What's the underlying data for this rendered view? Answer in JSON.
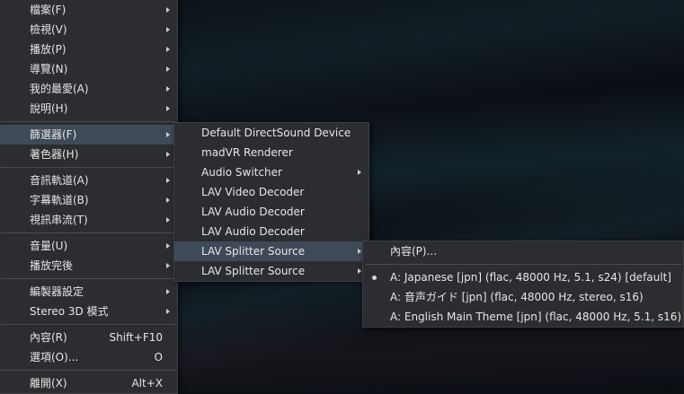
{
  "main_menu": {
    "groups": [
      [
        {
          "label": "檔案(F)",
          "submenu": true
        },
        {
          "label": "檢視(V)",
          "submenu": true
        },
        {
          "label": "播放(P)",
          "submenu": true
        },
        {
          "label": "導覽(N)",
          "submenu": true
        },
        {
          "label": "我的最愛(A)",
          "submenu": true
        },
        {
          "label": "說明(H)",
          "submenu": true
        }
      ],
      [
        {
          "label": "篩選器(F)",
          "submenu": true,
          "highlighted": true
        },
        {
          "label": "著色器(H)",
          "submenu": true
        }
      ],
      [
        {
          "label": "音訊軌道(A)",
          "submenu": true
        },
        {
          "label": "字幕軌道(B)",
          "submenu": true
        },
        {
          "label": "視訊串流(T)",
          "submenu": true
        }
      ],
      [
        {
          "label": "音量(U)",
          "submenu": true
        },
        {
          "label": "播放完後",
          "submenu": true
        }
      ],
      [
        {
          "label": "編製器設定",
          "submenu": true
        },
        {
          "label": "Stereo 3D 模式",
          "submenu": true
        }
      ],
      [
        {
          "label": "內容(R)",
          "shortcut": "Shift+F10"
        },
        {
          "label": "選項(O)...",
          "shortcut": "O"
        }
      ],
      [
        {
          "label": "離開(X)",
          "shortcut": "Alt+X"
        }
      ]
    ]
  },
  "filters_menu": {
    "items": [
      {
        "label": "Default DirectSound Device"
      },
      {
        "label": "madVR Renderer"
      },
      {
        "label": "Audio Switcher",
        "submenu": true
      },
      {
        "label": "LAV Video Decoder"
      },
      {
        "label": "LAV Audio Decoder"
      },
      {
        "label": "LAV Audio Decoder"
      },
      {
        "label": "LAV Splitter Source",
        "submenu": true,
        "highlighted": true
      },
      {
        "label": "LAV Splitter Source",
        "submenu": true
      }
    ]
  },
  "lav_splitter_menu": {
    "properties_label": "內容(P)...",
    "streams": [
      {
        "label": "A: Japanese [jpn] (flac, 48000 Hz, 5.1, s24) [default]",
        "selected": true
      },
      {
        "label": "A: 音声ガイド [jpn] (flac, 48000 Hz, stereo, s16)",
        "selected": false
      },
      {
        "label": "A: English Main Theme [jpn] (flac, 48000 Hz, 5.1, s16)",
        "selected": false
      }
    ]
  }
}
